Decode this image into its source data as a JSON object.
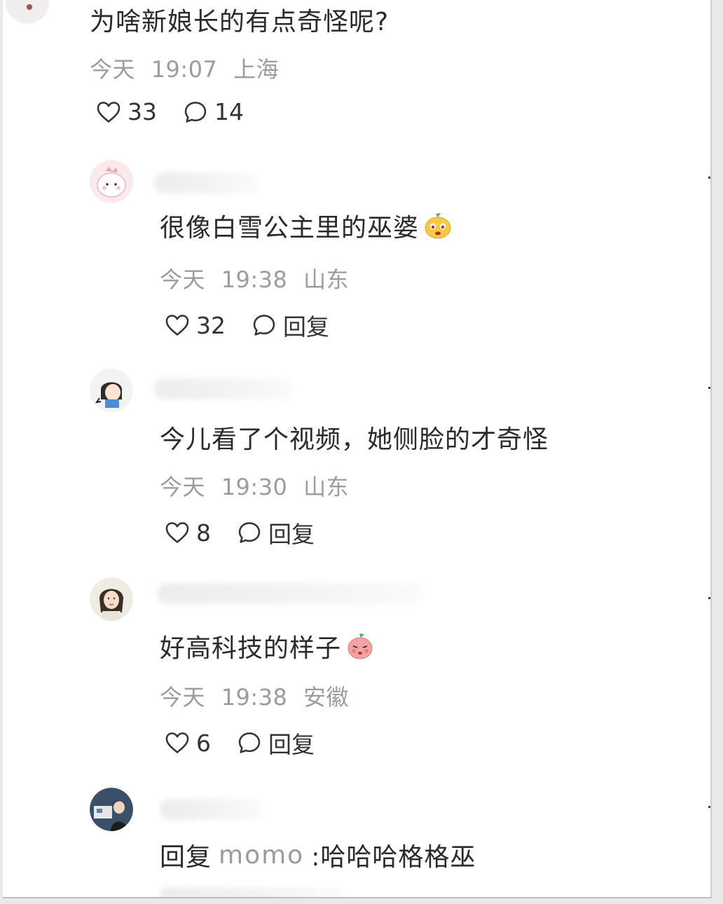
{
  "top_post": {
    "text": "为啥新娘长的有点奇怪呢?",
    "date": "今天",
    "time": "19:07",
    "location": "上海",
    "likes": "33",
    "comments": "14"
  },
  "comments": [
    {
      "text": "很像白雪公主里的巫婆",
      "emoji": "sly-face-emoji",
      "date": "今天",
      "time": "19:38",
      "location": "山东",
      "likes": "32",
      "reply_label": "回复"
    },
    {
      "text": "今儿看了个视频，她侧脸的才奇怪",
      "date": "今天",
      "time": "19:30",
      "location": "山东",
      "likes": "8",
      "reply_label": "回复"
    },
    {
      "text": "好高科技的样子",
      "emoji": "blushing-face-emoji",
      "date": "今天",
      "time": "19:38",
      "location": "安徽",
      "likes": "6",
      "reply_label": "回复"
    },
    {
      "reply_prefix": "回复",
      "reply_to": "momo",
      "text": ":哈哈哈格格巫"
    }
  ],
  "colors": {
    "text": "#2a2a2a",
    "meta": "#9c9c9c",
    "background": "#ffffff"
  }
}
